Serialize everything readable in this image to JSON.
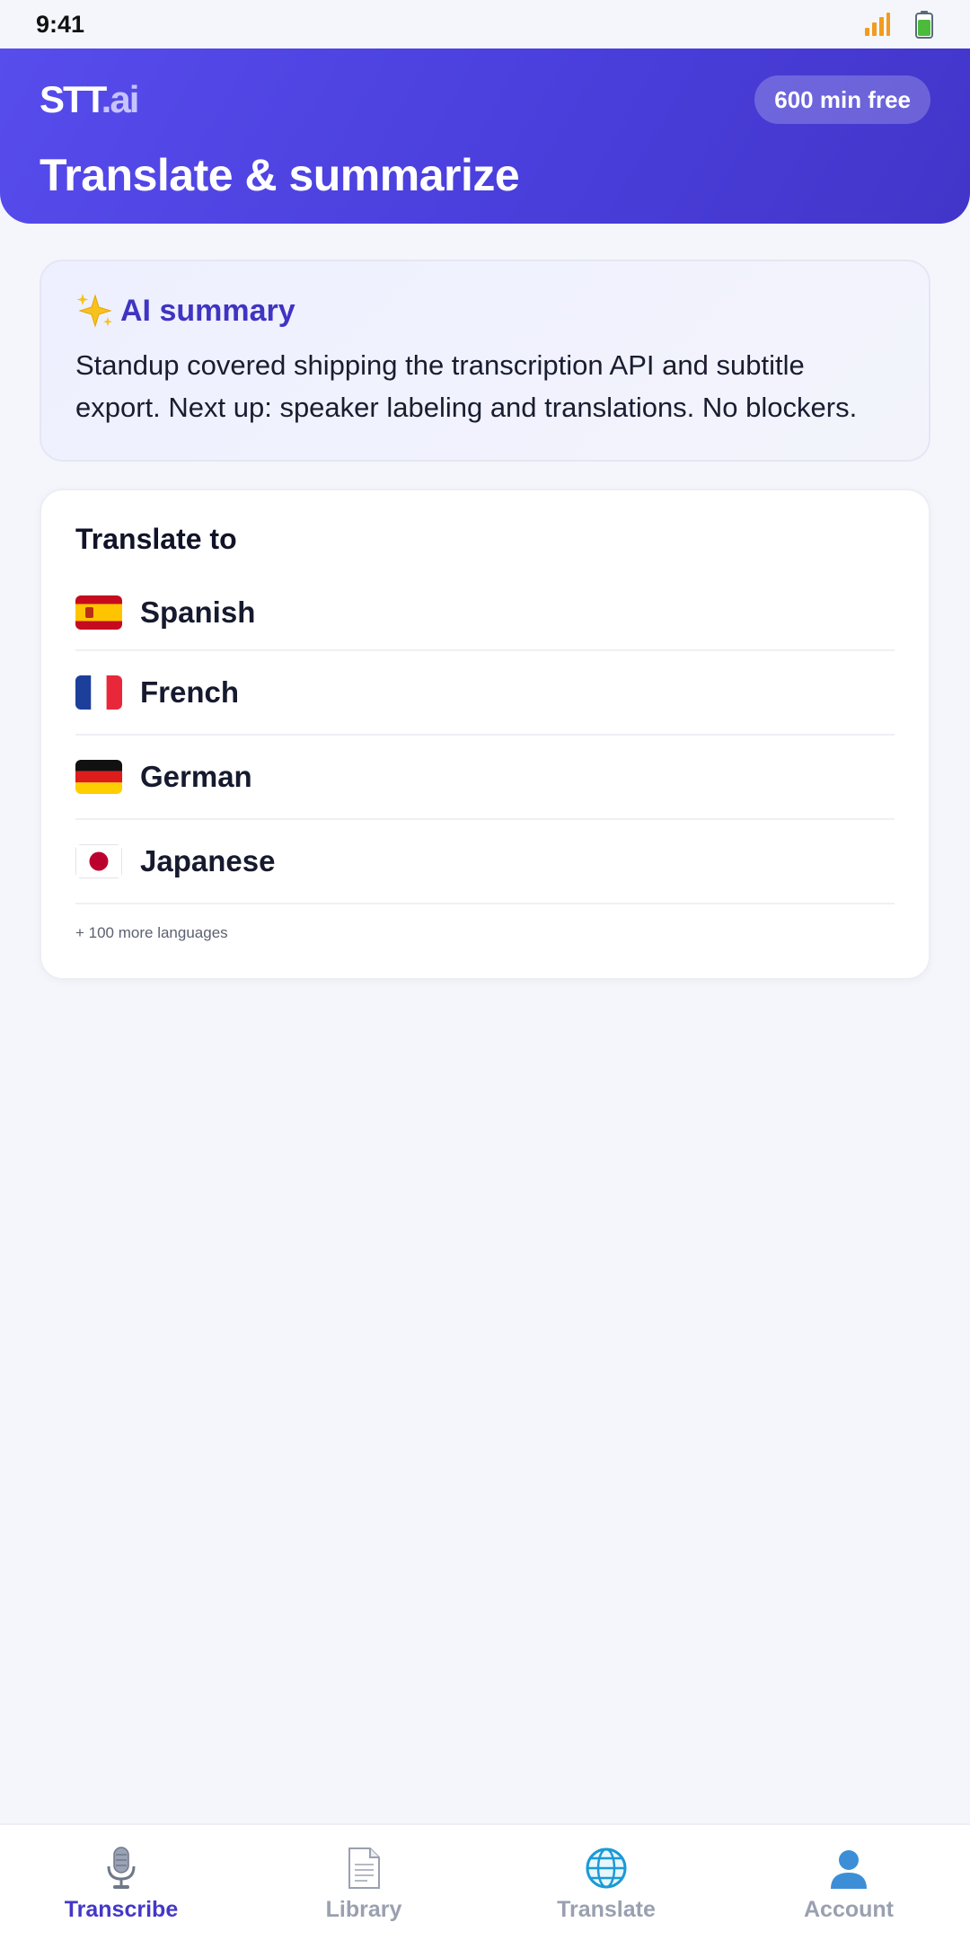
{
  "status_bar": {
    "time": "9:41"
  },
  "header": {
    "brand_main": "STT",
    "brand_suffix": ".ai",
    "free_badge": "600 min free",
    "title": "Translate & summarize"
  },
  "summary": {
    "heading": "AI summary",
    "icon": "sparkles-icon",
    "text": "Standup covered shipping the transcription API and subtitle export. Next up: speaker labeling and translations. No blockers."
  },
  "translate": {
    "heading": "Translate to",
    "languages": [
      {
        "name": "Spanish",
        "flag": "spain-flag-icon"
      },
      {
        "name": "French",
        "flag": "france-flag-icon"
      },
      {
        "name": "German",
        "flag": "germany-flag-icon"
      },
      {
        "name": "Japanese",
        "flag": "japan-flag-icon"
      }
    ],
    "more": "+ 100 more languages"
  },
  "nav": {
    "active_color": "#4438c8",
    "inactive_color": "#9aa0b0",
    "items": [
      {
        "label": "Transcribe",
        "icon": "microphone-icon",
        "active": true
      },
      {
        "label": "Library",
        "icon": "document-icon",
        "active": false
      },
      {
        "label": "Translate",
        "icon": "globe-icon",
        "active": false
      },
      {
        "label": "Account",
        "icon": "user-icon",
        "active": false
      }
    ]
  },
  "colors": {
    "header_start": "#574cec",
    "header_end": "#4235c9",
    "summary_accent": "#4034c2"
  }
}
